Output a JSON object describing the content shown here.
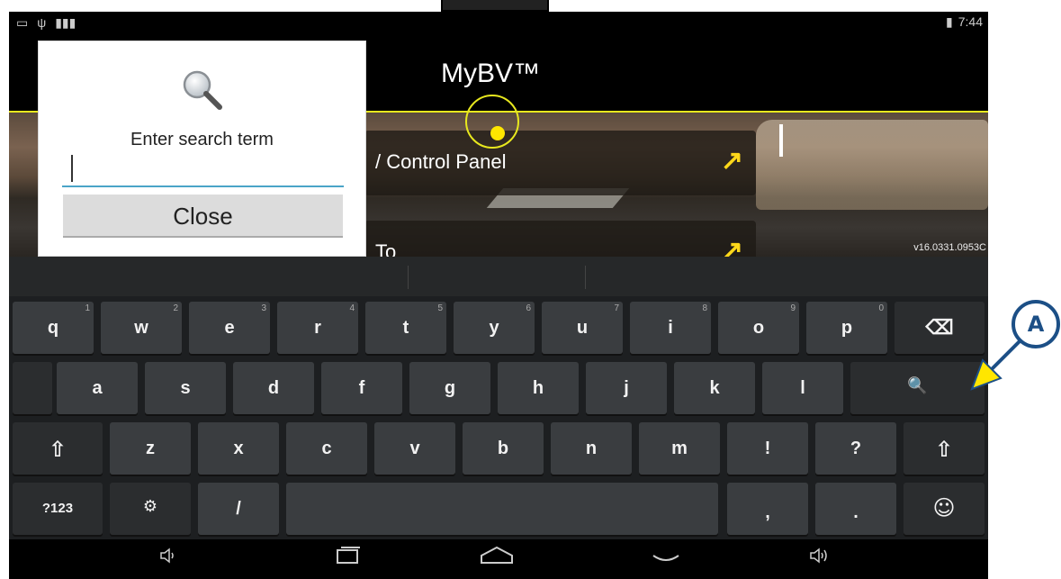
{
  "status_bar": {
    "left_icons": [
      "screenshot-icon",
      "usb-icon",
      "barcode-icon"
    ],
    "battery_icon": "battery-charging-icon",
    "time": "7:44"
  },
  "app": {
    "title": "MyBV™",
    "buttons": [
      {
        "label": "/ Control Panel",
        "arrow": "↗"
      },
      {
        "label": "To",
        "arrow": "↗"
      }
    ],
    "version": "v16.0331.0953C"
  },
  "dialog": {
    "prompt": "Enter search term",
    "input_value": "",
    "close_label": "Close",
    "icon": "magnifier-icon"
  },
  "keyboard": {
    "row1": [
      {
        "key": "q",
        "hint": "1"
      },
      {
        "key": "w",
        "hint": "2"
      },
      {
        "key": "e",
        "hint": "3"
      },
      {
        "key": "r",
        "hint": "4"
      },
      {
        "key": "t",
        "hint": "5"
      },
      {
        "key": "y",
        "hint": "6"
      },
      {
        "key": "u",
        "hint": "7"
      },
      {
        "key": "i",
        "hint": "8"
      },
      {
        "key": "o",
        "hint": "9"
      },
      {
        "key": "p",
        "hint": "0"
      }
    ],
    "backspace": "⌫",
    "row2": [
      "a",
      "s",
      "d",
      "f",
      "g",
      "h",
      "j",
      "k",
      "l"
    ],
    "search_key": "🔍",
    "row3": [
      "z",
      "x",
      "c",
      "v",
      "b",
      "n",
      "m",
      "!",
      "?"
    ],
    "shift": "⇧",
    "symbols_key": "?123",
    "settings_key": "⚙",
    "slash_key": "/",
    "comma_key": ",",
    "period_key": ".",
    "emoji_key": "☺"
  },
  "navbar": {
    "icons": [
      "volume-down-icon",
      "recent-apps-icon",
      "home-icon",
      "hide-keyboard-icon",
      "volume-up-icon"
    ]
  },
  "annotation": {
    "label": "A",
    "color": "#1c4f86",
    "arrow_color": "#ffe600"
  }
}
